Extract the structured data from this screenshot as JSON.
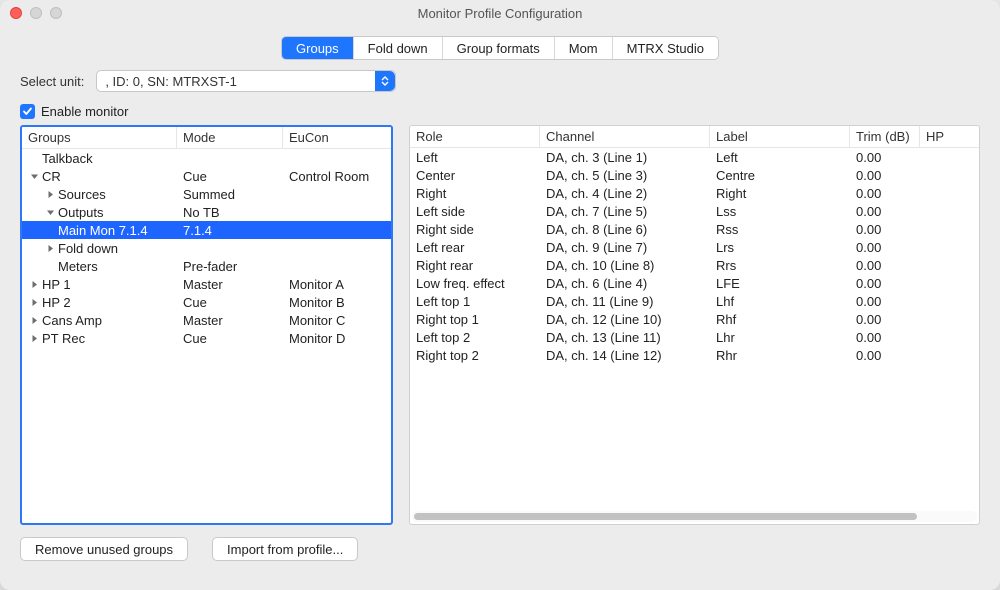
{
  "window_title": "Monitor Profile Configuration",
  "tabs": [
    "Groups",
    "Fold down",
    "Group formats",
    "Mom",
    "MTRX Studio"
  ],
  "active_tab_index": 0,
  "select_unit_label": "Select unit:",
  "select_unit_value": ", ID: 0, SN: MTRXST-1",
  "enable_monitor_label": "Enable monitor",
  "enable_monitor_checked": true,
  "left_headers": [
    "Groups",
    "Mode",
    "EuCon"
  ],
  "left_rows": [
    {
      "indent": 0,
      "tri": "",
      "name": "Talkback",
      "mode": "",
      "eucon": "",
      "selected": false
    },
    {
      "indent": 0,
      "tri": "down",
      "name": "CR",
      "mode": "Cue",
      "eucon": "Control Room",
      "selected": false
    },
    {
      "indent": 1,
      "tri": "right",
      "name": "Sources",
      "mode": "Summed",
      "eucon": "",
      "selected": false
    },
    {
      "indent": 1,
      "tri": "down",
      "name": "Outputs",
      "mode": "No TB",
      "eucon": "",
      "selected": false
    },
    {
      "indent": 2,
      "tri": "",
      "name": "Main Mon 7.1.4",
      "mode": "7.1.4",
      "eucon": "",
      "selected": true
    },
    {
      "indent": 1,
      "tri": "right",
      "name": "Fold down",
      "mode": "",
      "eucon": "",
      "selected": false
    },
    {
      "indent": 2,
      "tri": "",
      "name": "Meters",
      "mode": "Pre-fader",
      "eucon": "",
      "selected": false
    },
    {
      "indent": 0,
      "tri": "right",
      "name": "HP 1",
      "mode": "Master",
      "eucon": "Monitor A",
      "selected": false
    },
    {
      "indent": 0,
      "tri": "right",
      "name": "HP 2",
      "mode": "Cue",
      "eucon": "Monitor B",
      "selected": false
    },
    {
      "indent": 0,
      "tri": "right",
      "name": "Cans Amp",
      "mode": "Master",
      "eucon": "Monitor C",
      "selected": false
    },
    {
      "indent": 0,
      "tri": "right",
      "name": "PT Rec",
      "mode": "Cue",
      "eucon": "Monitor D",
      "selected": false
    }
  ],
  "right_headers": [
    "Role",
    "Channel",
    "Label",
    "Trim (dB)",
    "HP"
  ],
  "right_rows": [
    {
      "role": "Left",
      "channel": "DA, ch. 3 (Line 1)",
      "label": "Left",
      "trim": "0.00"
    },
    {
      "role": "Center",
      "channel": "DA, ch. 5 (Line 3)",
      "label": "Centre",
      "trim": "0.00"
    },
    {
      "role": "Right",
      "channel": "DA, ch. 4 (Line 2)",
      "label": "Right",
      "trim": "0.00"
    },
    {
      "role": "Left side",
      "channel": "DA, ch. 7 (Line 5)",
      "label": "Lss",
      "trim": "0.00"
    },
    {
      "role": "Right side",
      "channel": "DA, ch. 8 (Line 6)",
      "label": "Rss",
      "trim": "0.00"
    },
    {
      "role": "Left rear",
      "channel": "DA, ch. 9 (Line 7)",
      "label": "Lrs",
      "trim": "0.00"
    },
    {
      "role": "Right rear",
      "channel": "DA, ch. 10 (Line 8)",
      "label": "Rrs",
      "trim": "0.00"
    },
    {
      "role": "Low freq. effect",
      "channel": "DA, ch. 6 (Line 4)",
      "label": "LFE",
      "trim": "0.00"
    },
    {
      "role": "Left top 1",
      "channel": "DA, ch. 11 (Line 9)",
      "label": "Lhf",
      "trim": "0.00"
    },
    {
      "role": "Right top 1",
      "channel": "DA, ch. 12 (Line 10)",
      "label": "Rhf",
      "trim": "0.00"
    },
    {
      "role": "Left top 2",
      "channel": "DA, ch. 13 (Line 11)",
      "label": "Lhr",
      "trim": "0.00"
    },
    {
      "role": "Right top 2",
      "channel": "DA, ch. 14 (Line 12)",
      "label": "Rhr",
      "trim": "0.00"
    }
  ],
  "buttons": {
    "remove_unused": "Remove unused groups",
    "import_profile": "Import from profile..."
  }
}
